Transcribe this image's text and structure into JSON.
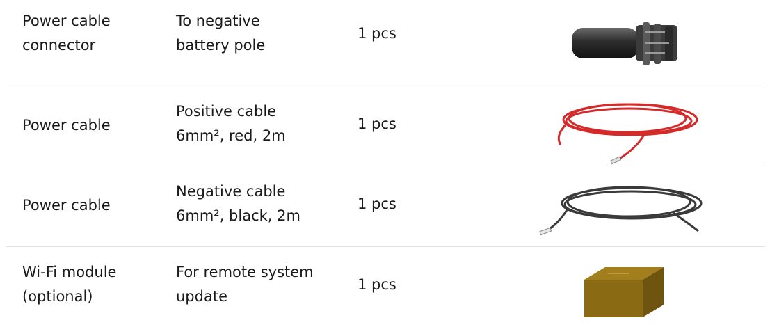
{
  "rows": [
    {
      "name": "Power cable\nconnector",
      "description": "To negative\nbattery pole",
      "quantity": "1 pcs",
      "image_icon": "power-cable-connector-image"
    },
    {
      "name": "Power cable",
      "description": "Positive cable\n6mm², red, 2m",
      "quantity": "1 pcs",
      "image_icon": "red-cable-coil-image"
    },
    {
      "name": "Power cable",
      "description": "Negative cable\n6mm², black, 2m",
      "quantity": "1 pcs",
      "image_icon": "black-cable-coil-image"
    },
    {
      "name": "Wi-Fi module\n(optional)",
      "description": "For remote system\nupdate",
      "quantity": "1 pcs",
      "image_icon": "wifi-module-image"
    }
  ],
  "colors": {
    "divider": "#e2e2e2",
    "red_cable": "#d42a2a",
    "black_cable": "#3a3a3a",
    "module_box": "#8a6a12"
  }
}
